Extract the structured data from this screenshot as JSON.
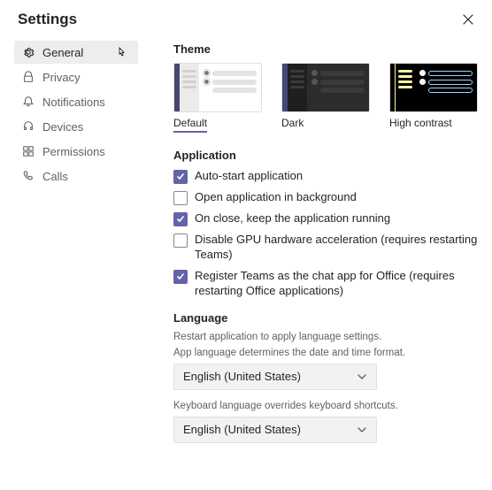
{
  "title": "Settings",
  "nav": {
    "general": "General",
    "privacy": "Privacy",
    "notifications": "Notifications",
    "devices": "Devices",
    "permissions": "Permissions",
    "calls": "Calls"
  },
  "theme": {
    "heading": "Theme",
    "default": "Default",
    "dark": "Dark",
    "high_contrast": "High contrast"
  },
  "app": {
    "heading": "Application",
    "autostart": "Auto-start application",
    "open_bg": "Open application in background",
    "on_close": "On close, keep the application running",
    "disable_gpu": "Disable GPU hardware acceleration (requires restarting Teams)",
    "register_chat": "Register Teams as the chat app for Office (requires restarting Office applications)"
  },
  "lang": {
    "heading": "Language",
    "restart_hint": "Restart application to apply language settings.",
    "app_lang_hint": "App language determines the date and time format.",
    "app_lang_value": "English (United States)",
    "kb_hint": "Keyboard language overrides keyboard shortcuts.",
    "kb_value": "English (United States)"
  }
}
